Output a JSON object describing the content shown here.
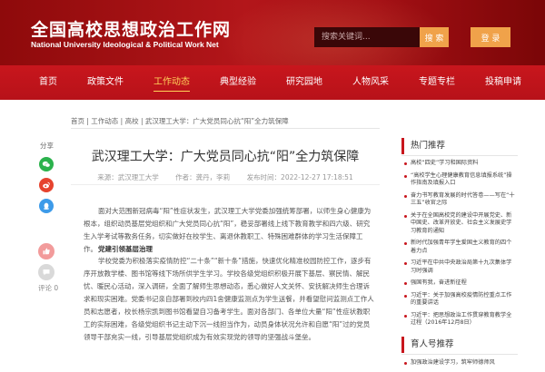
{
  "header": {
    "logo_cn": "全国高校思想政治工作网",
    "logo_en": "National University Ideological & Political Work Net",
    "search_placeholder": "搜索关键词...",
    "search_label": "搜 索",
    "login_label": "登 录"
  },
  "nav": {
    "items": [
      {
        "label": "首页"
      },
      {
        "label": "政策文件"
      },
      {
        "label": "工作动态"
      },
      {
        "label": "典型经验"
      },
      {
        "label": "研究园地"
      },
      {
        "label": "人物风采"
      },
      {
        "label": "专题专栏"
      },
      {
        "label": "投稿申请"
      }
    ],
    "active_index": 2
  },
  "breadcrumb": "首页 | 工作动态 | 高校 | 武汉理工大学：广大党员同心抗“阳”全力筑保障",
  "share": {
    "label": "分享",
    "comment_label": "评论 0"
  },
  "article": {
    "title": "武汉理工大学：广大党员同心抗“阳”全力筑保障",
    "source": "来源：武汉理工大学",
    "author": "作者：龚丹，李莉",
    "date": "发布时间：2022-12-27 17:18:51",
    "para1": "面对大范围新冠病毒“阳”性症状发生，武汉理工大学党委加强统筹部署，以师生身心健康为根本，组织动员基层党组织和广大党员同心抗“阳”，稳妥部署线上线下教育教学和四六级、研究生入学考试等教务任务，切实做好在校学生、离退休教职工、特殊困难群体的学习生活保障工作。",
    "subhead": "党建引领基层治理",
    "para2": "学校党委为积极落实疫情防控“二十条”“新十条”措施，快速优化精准校园防控工作，逐步有序开放教学楼、图书馆等线下场所供学生学习。学校各级党组织积极开展下基层、察民情、解民忧、暖民心活动，深入调研，全面了解师生思想动态，悉心做好人文关怀、安抚解决师生合理诉求和现实困难。党委书记亲自部署到校内四1舍健康监测点为学生送餐，并看望慰问监测点工作人员和志愿者，校长杨宗凯到图书馆看望自习备考学生。面对各部门、各单位大量“阳”性症状教职工的实际困难，各级党组织书记主动下沉一线担当作为，动员身体状况允许和自愿“阳”过的党员领导干部充实一线，引导基层党组织成为有效实现党的领导的坚强战斗堡垒。"
  },
  "sidebar": {
    "hot_title": "热门推荐",
    "hot_items": [
      "高校“四史”学习和国际资料",
      "“高校学生心理健康教育信息填报系统”操作指南及填报入口",
      "奋力书写教育发展的时代答卷——写在“十三五”收官之际",
      "关于在全国高校党的建设中开展党史、新中国史、改革开放史、社会主义发展史学习教育的通知",
      "新时代加强青年学生爱国主义教育的四个着力点",
      "习近平在中共中央政治局第十九次集体学习时强调",
      "强国有我，奋进新征程",
      "习近平：关于加强高校疫情防控重点工作的重要讲话",
      "习近平：把思想政治工作贯穿教育教学全过程（2016年12月8日）"
    ],
    "edu_title": "育人号推荐",
    "edu_items": [
      "加强政治建设学习，筑牢师德师风"
    ]
  },
  "colors": {
    "brand_red": "#c8161d",
    "header_dark": "#8e0a0b",
    "accent_orange": "#f0a24a",
    "nav_active": "#ffd35a"
  }
}
